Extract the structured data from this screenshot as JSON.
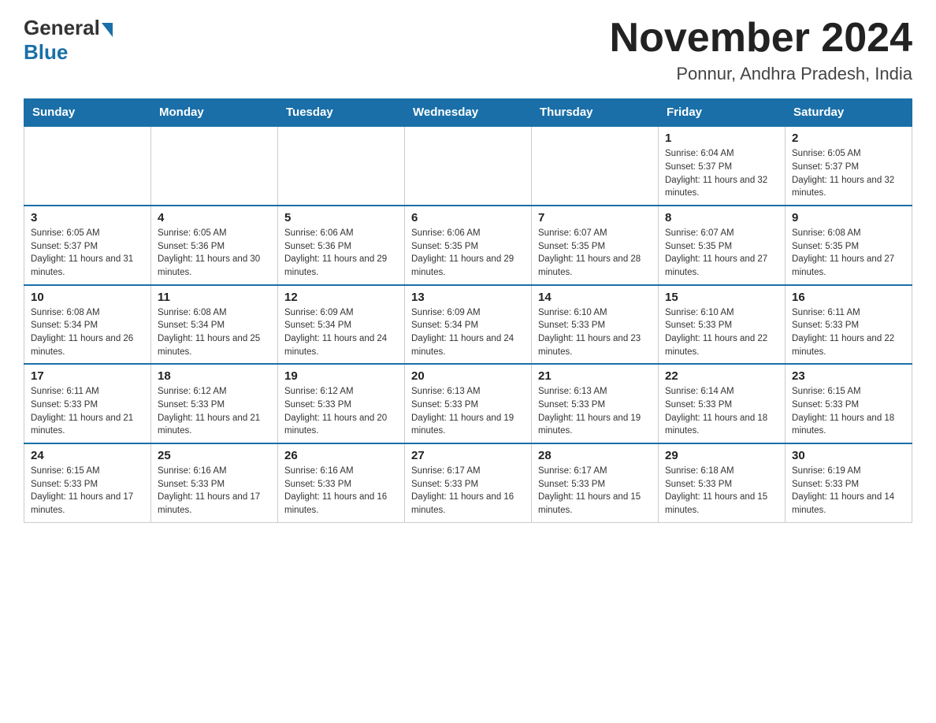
{
  "header": {
    "logo_general": "General",
    "logo_blue": "Blue",
    "title": "November 2024",
    "subtitle": "Ponnur, Andhra Pradesh, India"
  },
  "weekdays": [
    "Sunday",
    "Monday",
    "Tuesday",
    "Wednesday",
    "Thursday",
    "Friday",
    "Saturday"
  ],
  "weeks": [
    [
      {
        "day": "",
        "info": ""
      },
      {
        "day": "",
        "info": ""
      },
      {
        "day": "",
        "info": ""
      },
      {
        "day": "",
        "info": ""
      },
      {
        "day": "",
        "info": ""
      },
      {
        "day": "1",
        "info": "Sunrise: 6:04 AM\nSunset: 5:37 PM\nDaylight: 11 hours and 32 minutes."
      },
      {
        "day": "2",
        "info": "Sunrise: 6:05 AM\nSunset: 5:37 PM\nDaylight: 11 hours and 32 minutes."
      }
    ],
    [
      {
        "day": "3",
        "info": "Sunrise: 6:05 AM\nSunset: 5:37 PM\nDaylight: 11 hours and 31 minutes."
      },
      {
        "day": "4",
        "info": "Sunrise: 6:05 AM\nSunset: 5:36 PM\nDaylight: 11 hours and 30 minutes."
      },
      {
        "day": "5",
        "info": "Sunrise: 6:06 AM\nSunset: 5:36 PM\nDaylight: 11 hours and 29 minutes."
      },
      {
        "day": "6",
        "info": "Sunrise: 6:06 AM\nSunset: 5:35 PM\nDaylight: 11 hours and 29 minutes."
      },
      {
        "day": "7",
        "info": "Sunrise: 6:07 AM\nSunset: 5:35 PM\nDaylight: 11 hours and 28 minutes."
      },
      {
        "day": "8",
        "info": "Sunrise: 6:07 AM\nSunset: 5:35 PM\nDaylight: 11 hours and 27 minutes."
      },
      {
        "day": "9",
        "info": "Sunrise: 6:08 AM\nSunset: 5:35 PM\nDaylight: 11 hours and 27 minutes."
      }
    ],
    [
      {
        "day": "10",
        "info": "Sunrise: 6:08 AM\nSunset: 5:34 PM\nDaylight: 11 hours and 26 minutes."
      },
      {
        "day": "11",
        "info": "Sunrise: 6:08 AM\nSunset: 5:34 PM\nDaylight: 11 hours and 25 minutes."
      },
      {
        "day": "12",
        "info": "Sunrise: 6:09 AM\nSunset: 5:34 PM\nDaylight: 11 hours and 24 minutes."
      },
      {
        "day": "13",
        "info": "Sunrise: 6:09 AM\nSunset: 5:34 PM\nDaylight: 11 hours and 24 minutes."
      },
      {
        "day": "14",
        "info": "Sunrise: 6:10 AM\nSunset: 5:33 PM\nDaylight: 11 hours and 23 minutes."
      },
      {
        "day": "15",
        "info": "Sunrise: 6:10 AM\nSunset: 5:33 PM\nDaylight: 11 hours and 22 minutes."
      },
      {
        "day": "16",
        "info": "Sunrise: 6:11 AM\nSunset: 5:33 PM\nDaylight: 11 hours and 22 minutes."
      }
    ],
    [
      {
        "day": "17",
        "info": "Sunrise: 6:11 AM\nSunset: 5:33 PM\nDaylight: 11 hours and 21 minutes."
      },
      {
        "day": "18",
        "info": "Sunrise: 6:12 AM\nSunset: 5:33 PM\nDaylight: 11 hours and 21 minutes."
      },
      {
        "day": "19",
        "info": "Sunrise: 6:12 AM\nSunset: 5:33 PM\nDaylight: 11 hours and 20 minutes."
      },
      {
        "day": "20",
        "info": "Sunrise: 6:13 AM\nSunset: 5:33 PM\nDaylight: 11 hours and 19 minutes."
      },
      {
        "day": "21",
        "info": "Sunrise: 6:13 AM\nSunset: 5:33 PM\nDaylight: 11 hours and 19 minutes."
      },
      {
        "day": "22",
        "info": "Sunrise: 6:14 AM\nSunset: 5:33 PM\nDaylight: 11 hours and 18 minutes."
      },
      {
        "day": "23",
        "info": "Sunrise: 6:15 AM\nSunset: 5:33 PM\nDaylight: 11 hours and 18 minutes."
      }
    ],
    [
      {
        "day": "24",
        "info": "Sunrise: 6:15 AM\nSunset: 5:33 PM\nDaylight: 11 hours and 17 minutes."
      },
      {
        "day": "25",
        "info": "Sunrise: 6:16 AM\nSunset: 5:33 PM\nDaylight: 11 hours and 17 minutes."
      },
      {
        "day": "26",
        "info": "Sunrise: 6:16 AM\nSunset: 5:33 PM\nDaylight: 11 hours and 16 minutes."
      },
      {
        "day": "27",
        "info": "Sunrise: 6:17 AM\nSunset: 5:33 PM\nDaylight: 11 hours and 16 minutes."
      },
      {
        "day": "28",
        "info": "Sunrise: 6:17 AM\nSunset: 5:33 PM\nDaylight: 11 hours and 15 minutes."
      },
      {
        "day": "29",
        "info": "Sunrise: 6:18 AM\nSunset: 5:33 PM\nDaylight: 11 hours and 15 minutes."
      },
      {
        "day": "30",
        "info": "Sunrise: 6:19 AM\nSunset: 5:33 PM\nDaylight: 11 hours and 14 minutes."
      }
    ]
  ]
}
